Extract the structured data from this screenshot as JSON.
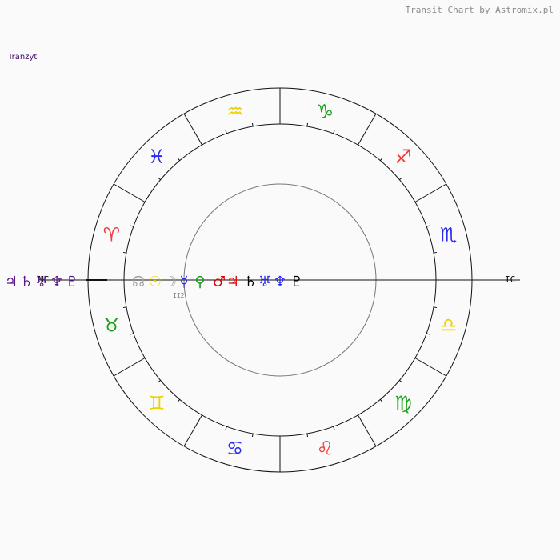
{
  "header": {
    "credit": "Transit Chart by Astromix.pl",
    "title": "Tranzyt"
  },
  "signs": [
    {
      "name": "capricorn",
      "symbol": "♑",
      "color": "#16a016"
    },
    {
      "name": "sagittarius",
      "symbol": "♐",
      "color": "#f03c3c"
    },
    {
      "name": "scorpio",
      "symbol": "♏",
      "color": "#2a2af0"
    },
    {
      "name": "libra",
      "symbol": "♎",
      "color": "#f0d000"
    },
    {
      "name": "virgo",
      "symbol": "♍",
      "color": "#16a016"
    },
    {
      "name": "leo",
      "symbol": "♌",
      "color": "#f03c3c"
    },
    {
      "name": "cancer",
      "symbol": "♋",
      "color": "#2a2af0"
    },
    {
      "name": "gemini",
      "symbol": "♊",
      "color": "#f0d000"
    },
    {
      "name": "taurus",
      "symbol": "♉",
      "color": "#16a016"
    },
    {
      "name": "aries",
      "symbol": "♈",
      "color": "#f03c3c"
    },
    {
      "name": "pisces",
      "symbol": "♓",
      "color": "#2a2af0"
    },
    {
      "name": "aquarius",
      "symbol": "♒",
      "color": "#f0d000"
    }
  ],
  "axis_labels": {
    "left": "MC",
    "right": "IC"
  },
  "transit_planets": [
    {
      "symbol": "♃",
      "color": "#5a1a8a"
    },
    {
      "symbol": "♄",
      "color": "#5a1a8a"
    },
    {
      "symbol": "♅",
      "color": "#5a1a8a"
    },
    {
      "symbol": "♆",
      "color": "#5a1a8a"
    },
    {
      "symbol": "♇",
      "color": "#5a1a8a"
    }
  ],
  "inner_planets": [
    {
      "symbol": "☊",
      "color": "#a0a0a0"
    },
    {
      "symbol": "☉",
      "color": "#f0d000"
    },
    {
      "symbol": "☽",
      "color": "#a0a0a0"
    },
    {
      "symbol": "☿",
      "color": "#2a2af0"
    },
    {
      "symbol": "♀",
      "color": "#16a016"
    },
    {
      "symbol": "♂",
      "color": "#e00000"
    },
    {
      "symbol": "♃",
      "color": "#e00000"
    },
    {
      "symbol": "♄",
      "color": "#000000"
    },
    {
      "symbol": "♅",
      "color": "#2a2af0"
    },
    {
      "symbol": "♆",
      "color": "#2a2af0"
    },
    {
      "symbol": "♇",
      "color": "#000000"
    }
  ],
  "small_label": "ӀӀ2"
}
